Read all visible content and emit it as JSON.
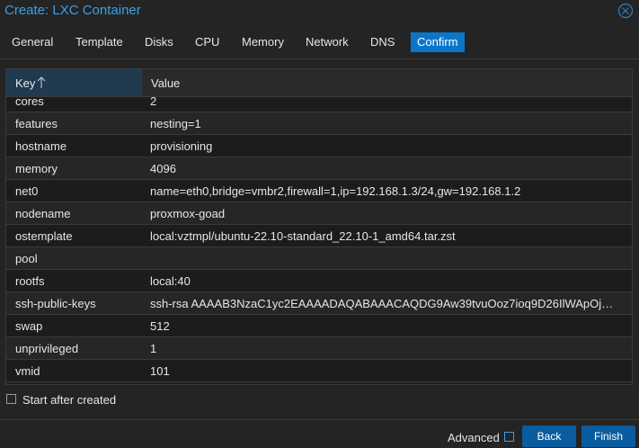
{
  "window": {
    "title": "Create: LXC Container"
  },
  "tabs": [
    "General",
    "Template",
    "Disks",
    "CPU",
    "Memory",
    "Network",
    "DNS",
    "Confirm"
  ],
  "active_tab": "Confirm",
  "grid": {
    "columns": {
      "key": "Key",
      "value": "Value"
    },
    "sort": {
      "column": "Key",
      "direction": "ascending"
    },
    "rows": [
      {
        "key": "cores",
        "value": "2"
      },
      {
        "key": "features",
        "value": "nesting=1"
      },
      {
        "key": "hostname",
        "value": "provisioning"
      },
      {
        "key": "memory",
        "value": "4096"
      },
      {
        "key": "net0",
        "value": "name=eth0,bridge=vmbr2,firewall=1,ip=192.168.1.3/24,gw=192.168.1.2"
      },
      {
        "key": "nodename",
        "value": "proxmox-goad"
      },
      {
        "key": "ostemplate",
        "value": "local:vztmpl/ubuntu-22.10-standard_22.10-1_amd64.tar.zst"
      },
      {
        "key": "pool",
        "value": ""
      },
      {
        "key": "rootfs",
        "value": "local:40"
      },
      {
        "key": "ssh-public-keys",
        "value": "ssh-rsa AAAAB3NzaC1yc2EAAAADAQABAAACAQDG9Aw39tvuOoz7ioq9D26IlWApOj…"
      },
      {
        "key": "swap",
        "value": "512"
      },
      {
        "key": "unprivileged",
        "value": "1"
      },
      {
        "key": "vmid",
        "value": "101"
      }
    ]
  },
  "start_after_created": {
    "label": "Start after created",
    "checked": false
  },
  "footer": {
    "advanced_label": "Advanced",
    "advanced_checked": false,
    "back_label": "Back",
    "finish_label": "Finish"
  },
  "colors": {
    "accent": "#0a75c9",
    "title": "#3e9fe6",
    "button": "#0b5c9e",
    "background": "#242424"
  },
  "icons": {
    "close": "close-circle-icon",
    "sort": "sort-ascending-icon"
  }
}
